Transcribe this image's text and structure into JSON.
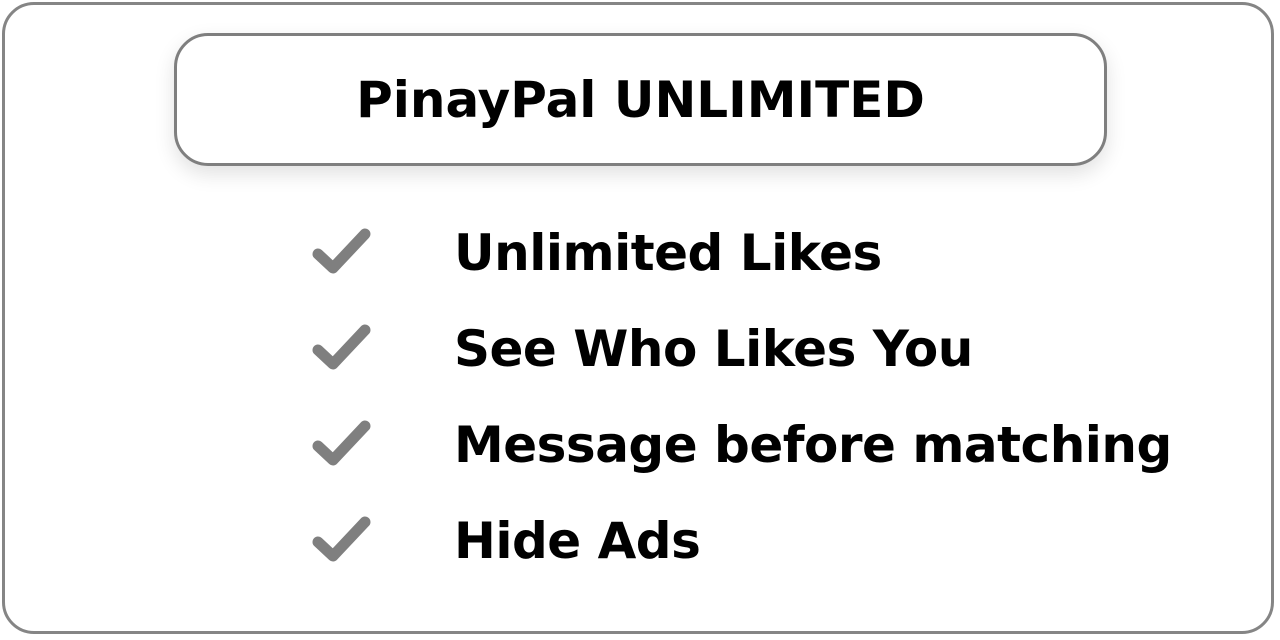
{
  "header": {
    "title": "PinayPal UNLIMITED"
  },
  "features": [
    {
      "label": "Unlimited Likes",
      "icon": "check-icon"
    },
    {
      "label": "See Who Likes You",
      "icon": "check-icon"
    },
    {
      "label": "Message before matching",
      "icon": "check-icon"
    },
    {
      "label": "Hide Ads",
      "icon": "check-icon"
    }
  ],
  "colors": {
    "border": "#858585",
    "check": "#7f7f7f",
    "text": "#000000",
    "background": "#ffffff"
  }
}
